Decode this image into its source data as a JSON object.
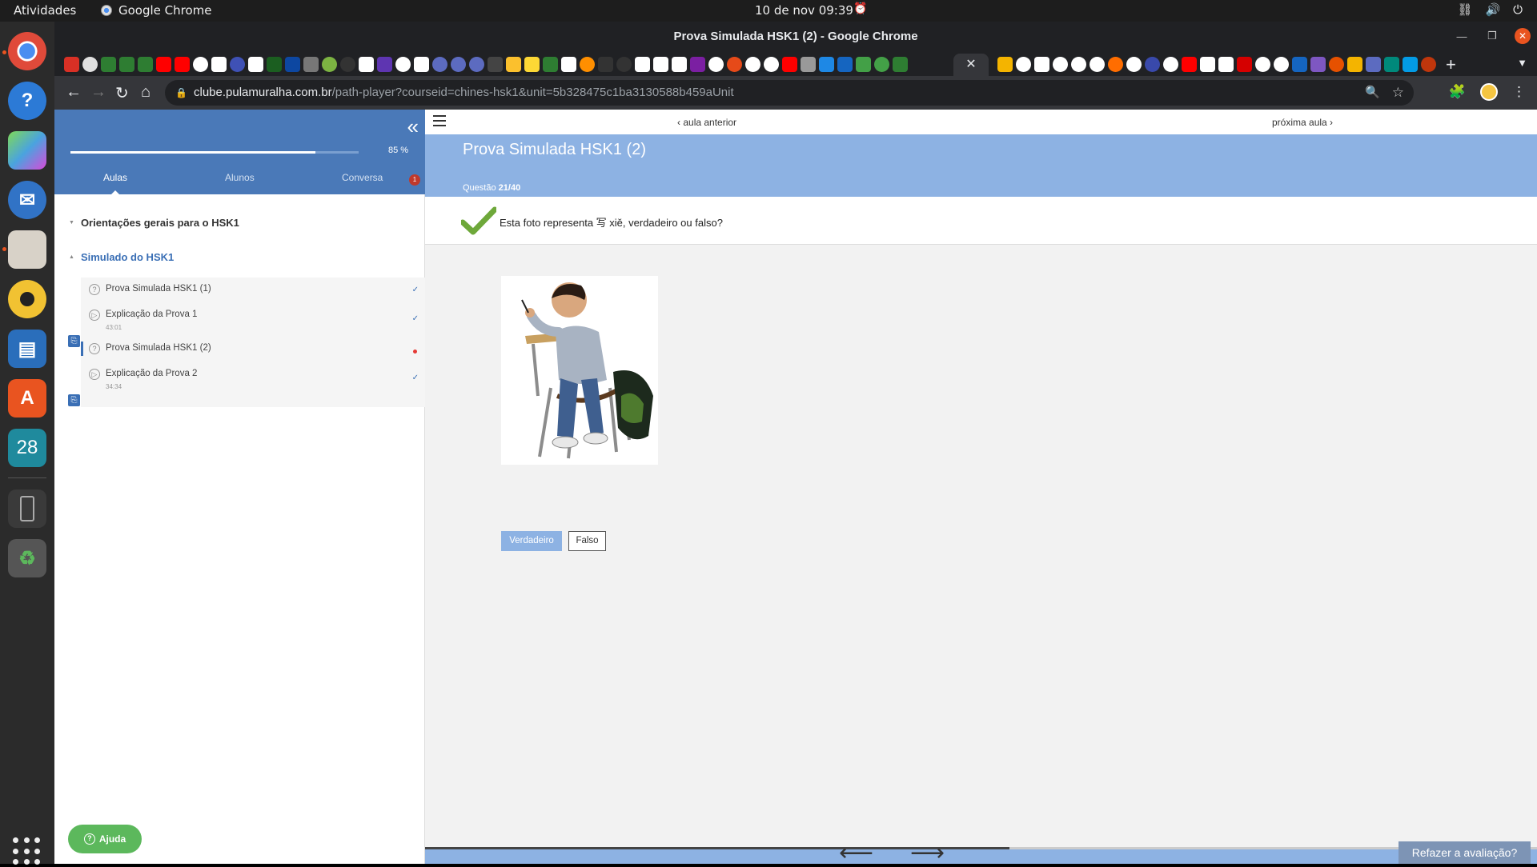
{
  "system": {
    "activities": "Atividades",
    "app_name": "Google Chrome",
    "clock": "10 de nov  09:39"
  },
  "dock": {
    "calendar_day": "28"
  },
  "window": {
    "title": "Prova Simulada HSK1 (2) - Google Chrome"
  },
  "browser": {
    "url_host": "clube.pulamuralha.com.br",
    "url_path": "/path-player?courseid=chines-hsk1&unit=5b328475c1ba3130588b459aUnit"
  },
  "sidebar": {
    "progress_percent": 85,
    "progress_label": "85 %",
    "tabs": [
      "Aulas",
      "Alunos",
      "Conversa"
    ],
    "chat_badge": "1",
    "sections": [
      "Orientações gerais para o HSK1",
      "Simulado do HSK1"
    ],
    "lessons": [
      {
        "title": "Prova Simulada HSK1 (1)",
        "duration": "",
        "status": "✓",
        "icon": "quiz-icon"
      },
      {
        "title": "Explicação da Prova 1",
        "duration": "43:01",
        "status": "✓",
        "icon": "video-icon"
      },
      {
        "title": "Prova Simulada HSK1 (2)",
        "duration": "",
        "status": "current",
        "icon": "quiz-icon"
      },
      {
        "title": "Explicação da Prova 2",
        "duration": "34:34",
        "status": "✓",
        "icon": "video-icon"
      }
    ],
    "help_label": "Ajuda"
  },
  "main": {
    "prev_label": "aula anterior",
    "next_label": "próxima aula",
    "title": "Prova Simulada HSK1 (2)",
    "question_label": "Questão",
    "question_number": "21/40",
    "question_text": "Esta foto representa 写 xiě, verdadeiro ou falso?",
    "answers": [
      "Verdadeiro",
      "Falso"
    ],
    "selected_answer": "Verdadeiro",
    "redo_label": "Refazer a avaliação?"
  },
  "colors": {
    "sidebar_header": "#4a79b8",
    "banner": "#8db2e3",
    "help_green": "#5cb85c",
    "check_green": "#6ea83a"
  }
}
